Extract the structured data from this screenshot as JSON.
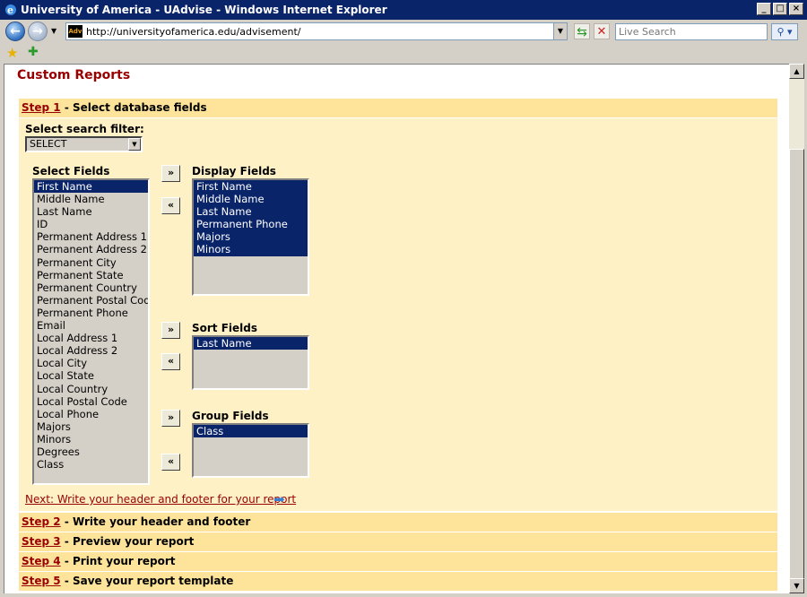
{
  "window": {
    "title": "University of America - UAdvise - Windows Internet Explorer"
  },
  "browser": {
    "url": "http://universityofamerica.edu/advisement/",
    "favicon_text": "Adv",
    "search_placeholder": "Live Search"
  },
  "page": {
    "title": "Custom Reports",
    "steps": [
      {
        "link": "Step 1",
        "text": " - Select database fields"
      },
      {
        "link": "Step 2",
        "text": " - Write your header and footer"
      },
      {
        "link": "Step 3",
        "text": " - Preview your report"
      },
      {
        "link": "Step 4",
        "text": " - Print your report"
      },
      {
        "link": "Step 5",
        "text": " - Save your report template"
      }
    ],
    "filter": {
      "label": "Select search filter:",
      "value": "SELECT"
    },
    "select_fields": {
      "label": "Select Fields",
      "items": [
        "First Name",
        "Middle Name",
        "Last Name",
        "ID",
        "Permanent Address 1",
        "Permanent Address 2",
        "Permanent City",
        "Permanent State",
        "Permanent Country",
        "Permanent Postal Code",
        "Permanent Phone",
        "Email",
        "Local Address 1",
        "Local Address 2",
        "Local City",
        "Local State",
        "Local Country",
        "Local Postal Code",
        "Local Phone",
        "Majors",
        "Minors",
        "Degrees",
        "Class"
      ],
      "selected": "First Name"
    },
    "display_fields": {
      "label": "Display Fields",
      "items": [
        "First Name",
        "Middle Name",
        "Last Name",
        "Permanent Phone",
        "Majors",
        "Minors"
      ]
    },
    "sort_fields": {
      "label": "Sort Fields",
      "items": [
        "Last Name"
      ]
    },
    "group_fields": {
      "label": "Group Fields",
      "items": [
        "Class"
      ]
    },
    "move_right": "»",
    "move_left": "«",
    "next_link": "Next: Write your header and footer for your report"
  }
}
